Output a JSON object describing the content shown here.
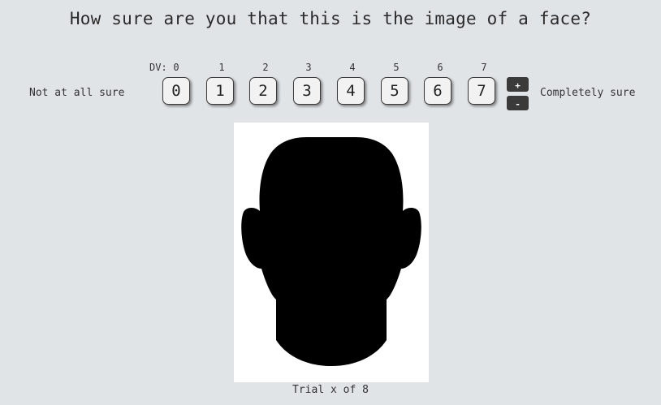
{
  "question": "How sure are you that this is the image of a face?",
  "scale": {
    "dv_prefix": "DV:",
    "labels": [
      "0",
      "1",
      "2",
      "3",
      "4",
      "5",
      "6",
      "7"
    ],
    "buttons": [
      "0",
      "1",
      "2",
      "3",
      "4",
      "5",
      "6",
      "7"
    ],
    "low_anchor": "Not at all sure",
    "high_anchor": "Completely sure",
    "increment_label": "+",
    "decrement_label": "-"
  },
  "stimulus": {
    "icon": "head-silhouette",
    "fill_color": "#000000",
    "background_color": "#ffffff"
  },
  "trial_text": "Trial x of 8",
  "colors": {
    "page_background": "#e1e4e7",
    "button_background": "#f2f2f2",
    "stepper_background": "#3a3a3a"
  }
}
